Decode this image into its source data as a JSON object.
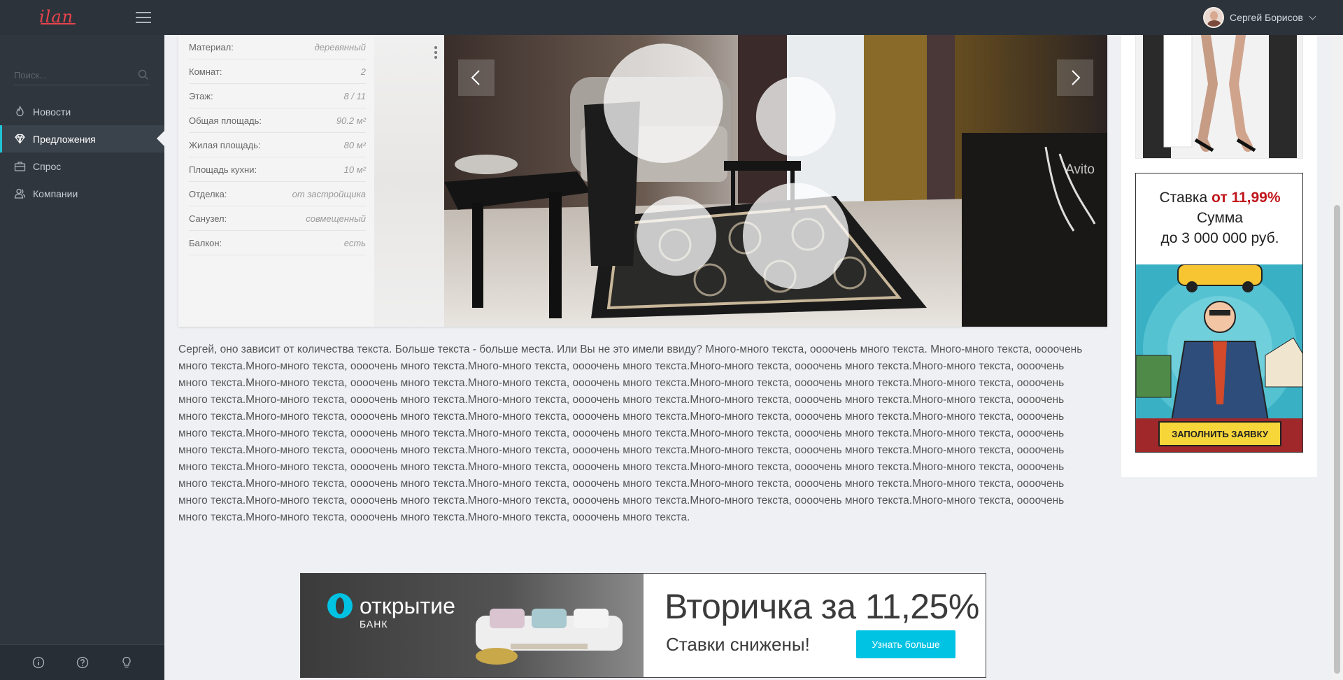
{
  "app": {
    "logo": "ilan",
    "user_name": "Сергей Борисов"
  },
  "sidebar": {
    "search_placeholder": "Поиск...",
    "items": [
      {
        "label": "Новости",
        "icon": "fire-icon",
        "active": false
      },
      {
        "label": "Предложения",
        "icon": "diamond-icon",
        "active": true
      },
      {
        "label": "Спрос",
        "icon": "briefcase-icon",
        "active": false
      },
      {
        "label": "Компании",
        "icon": "users-icon",
        "active": false
      }
    ],
    "footer_icons": [
      "info-icon",
      "help-icon",
      "lightbulb-icon"
    ]
  },
  "listing": {
    "properties": [
      {
        "label": "Материал:",
        "value": "деревянный"
      },
      {
        "label": "Комнат:",
        "value": "2"
      },
      {
        "label": "Этаж:",
        "value": "8 / 11"
      },
      {
        "label": "Общая площадь:",
        "value": "90.2 м²"
      },
      {
        "label": "Жилая площадь:",
        "value": "80 м²"
      },
      {
        "label": "Площадь кухни:",
        "value": "10 м²"
      },
      {
        "label": "Отделка:",
        "value": "от застройщика"
      },
      {
        "label": "Санузел:",
        "value": "совмещенный"
      },
      {
        "label": "Балкон:",
        "value": "есть"
      }
    ],
    "photo_watermark": "Avito",
    "description": "Сергей, оно зависит от количества текста. Больше текста - больше места. Или Вы не это имели ввиду? Много-много текста, оооочень много текста. Много-много текста, оооочень много текста.Много-много текста, оооочень много текста.Много-много текста, оооочень много текста.Много-много текста, оооочень много текста.Много-много текста, оооочень много текста.Много-много текста, оооочень много текста.Много-много текста, оооочень много текста.Много-много текста, оооочень много текста.Много-много текста, оооочень много текста.Много-много текста, оооочень много текста.Много-много текста, оооочень много текста.Много-много текста, оооочень много текста.Много-много текста, оооочень много текста.Много-много текста, оооочень много текста.Много-много текста, оооочень много текста.Много-много текста, оооочень много текста.Много-много текста, оооочень много текста.Много-много текста, оооочень много текста.Много-много текста, оооочень много текста.Много-много текста, оооочень много текста.Много-много текста, оооочень много текста.Много-много текста, оооочень много текста.Много-много текста, оооочень много текста.Много-много текста, оооочень много текста.Много-много текста, оооочень много текста.Много-много текста, оооочень много текста.Много-много текста, оооочень много текста.Много-много текста, оооочень много текста.Много-много текста, оооочень много текста.Много-много текста, оооочень много текста.Много-много текста, оооочень много текста.Много-много текста, оооочень много текста.Много-много текста, оооочень много текста.Много-много текста, оооочень много текста.Много-много текста, оооочень много текста.Много-много текста, оооочень много текста.Много-много текста, оооочень много текста.Много-много текста, оооочень много текста.Много-много текста, оооочень много текста."
  },
  "bank_ad": {
    "brand": "открытие",
    "brand_sub": "БАНК",
    "headline": "Вторичка за 11,25%",
    "subline": "Ставки снижены!",
    "button": "Узнать больше",
    "accent": "#00c2e3"
  },
  "side_ad": {
    "line1_prefix": "Ставка ",
    "line1_rate": "от 11,99%",
    "line2": "Сумма",
    "line3": "до 3 000 000 руб.",
    "button": "ЗАПОЛНИТЬ ЗАЯВКУ",
    "rate_color": "#c0161c"
  },
  "colors": {
    "topbar": "#2c333b",
    "sidebar": "#2f363e",
    "active_accent": "#20c3d4",
    "logo": "#e8434c"
  }
}
